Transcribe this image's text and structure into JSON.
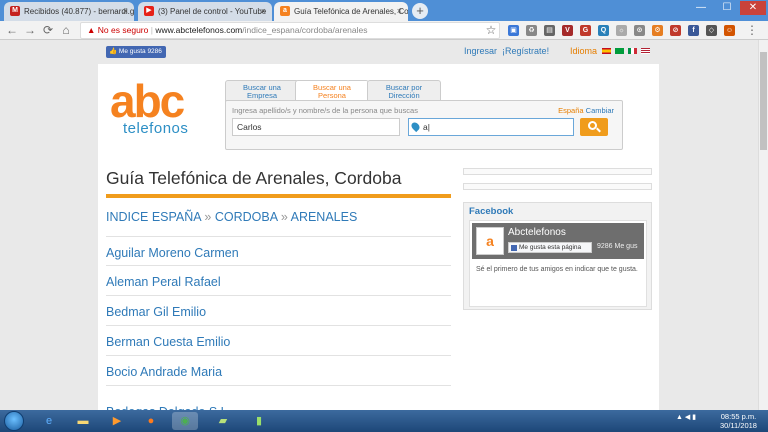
{
  "browser": {
    "tabs": [
      {
        "title": "Recibidos (40.877) - bernardi.gu...",
        "favicon": "gmail-icon",
        "color": "#c5221f",
        "close": "×"
      },
      {
        "title": "(3) Panel de control - YouTube",
        "favicon": "youtube-icon",
        "color": "#e62117",
        "close": "×"
      },
      {
        "title": "Guía Telefónica de Arenales, Cor...",
        "favicon": "abc-icon",
        "color": "#f58220",
        "close": "×"
      }
    ],
    "new_tab": "+",
    "window_controls": [
      "—",
      "☐",
      "✕"
    ],
    "nav": {
      "back": "←",
      "forward": "→",
      "reload": "⟳",
      "home": "⌂"
    },
    "address": {
      "security_icon": "▲",
      "security": "No es seguro",
      "separator": "|",
      "url_host": "www.abctelefonos.com",
      "url_path": "/indice_espana/cordoba/arenales"
    },
    "bookmark_star": "☆",
    "menu": "⋮"
  },
  "page": {
    "fb_like_top": "👍 Me gusta 9286",
    "login": "Ingresar",
    "register": "¡Regístrate!",
    "language": "Idioma",
    "logo": {
      "main": "abc",
      "sub": "telefonos"
    },
    "search_tabs": [
      {
        "line1": "Buscar una",
        "line2": "Empresa"
      },
      {
        "line1": "Buscar una",
        "line2": "Persona"
      },
      {
        "line1": "Buscar por",
        "line2": "Dirección"
      }
    ],
    "search": {
      "hint": "Ingresa apellido/s y nombre/s de la persona que buscas",
      "country": "España",
      "change": "Cambiar",
      "name_value": "Carlos",
      "location_value": "a|"
    },
    "title": "Guía Telefónica de Arenales, Cordoba",
    "breadcrumb": {
      "home": "INDICE ESPAÑA",
      "sep1": "»",
      "province": "CORDOBA",
      "sep2": "»",
      "city": "ARENALES"
    },
    "results": [
      "Aguilar Moreno Carmen",
      "Aleman Peral Rafael",
      "Bedmar Gil Emilio",
      "Berman Cuesta Emilio",
      "Bocio Andrade Maria",
      "Bodegas Delgado S.L."
    ],
    "facebook": {
      "title": "Facebook",
      "page_name": "Abctelefonos",
      "like_btn": "Me gusta esta página",
      "count": "9286 Me gus",
      "message": "Sé el primero de tus amigos en indicar que te gusta."
    }
  },
  "taskbar": {
    "clock_time": "08:55 p.m.",
    "clock_date": "30/11/2018",
    "tray": "▲ ◀ ▮"
  }
}
